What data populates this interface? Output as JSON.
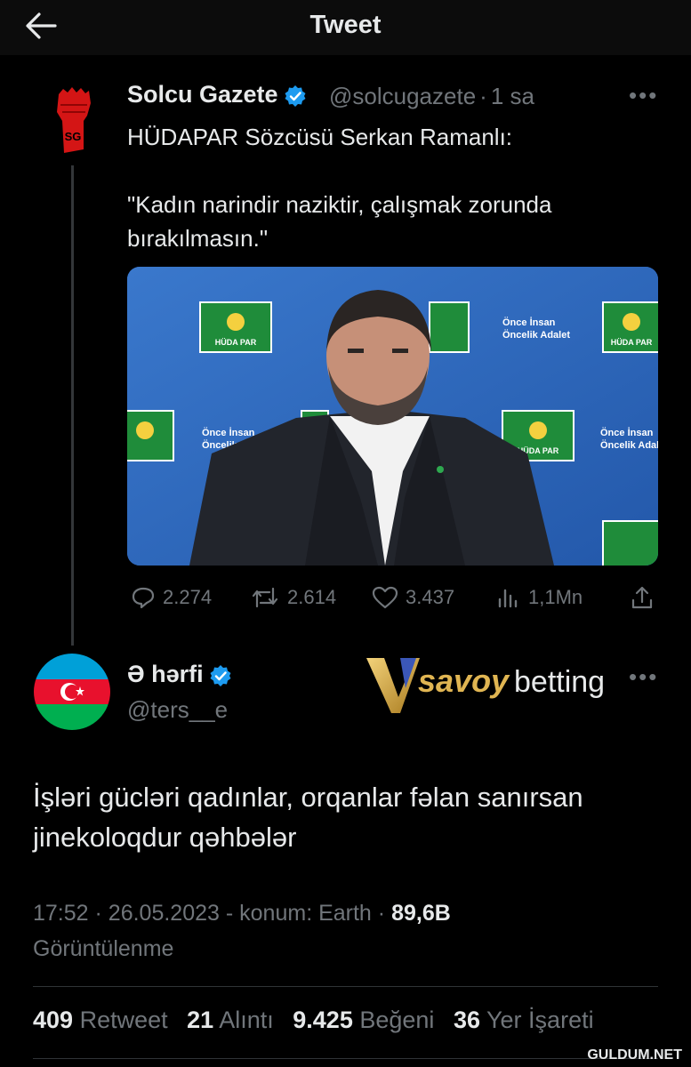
{
  "header": {
    "title": "Tweet"
  },
  "quoted_tweet": {
    "author_name": "Solcu Gazete",
    "handle": "@solcugazete",
    "separator": "·",
    "time": "1 sa",
    "text_lines": [
      "HÜDAPAR Sözcüsü Serkan Ramanlı:",
      "",
      "\"Kadın narindir naziktir, çalışmak zorunda",
      "bırakılmasın.\""
    ],
    "avatar_label": "SG",
    "image": {
      "backdrop_slogan_line1": "Önce İnsan",
      "backdrop_slogan_line2": "Öncelik Adalet",
      "backdrop_logo": "HÜDA PAR"
    },
    "stats": {
      "replies": "2.274",
      "retweets": "2.614",
      "likes": "3.437",
      "views": "1,1Mn"
    }
  },
  "main_tweet": {
    "author_name": "Ə hərfi",
    "handle": "@ters__e",
    "text_lines": [
      "İşləri gücləri qadınlar, orqanlar fəlan sanırsan",
      "jinekoloqdur qəhbələr"
    ],
    "time": "17:52",
    "date": "26.05.2023",
    "location": "konum: Earth",
    "views": "89,6B",
    "views_label": "Görüntülenme",
    "retweets_count": "409",
    "retweets_label": "Retweet",
    "quotes_count": "21",
    "quotes_label": "Alıntı",
    "likes_count": "9.425",
    "likes_label": "Beğeni",
    "bookmarks_count": "36",
    "bookmarks_label": "Yer İşareti"
  },
  "ad": {
    "brand_part1": "savoy",
    "brand_part2": "betting"
  },
  "more_icon": "•••",
  "watermark": "GULDUM.NET",
  "colors": {
    "verified": "#1d9bf0",
    "muted": "#71767b",
    "text": "#e7e9ea",
    "background": "#000000"
  }
}
